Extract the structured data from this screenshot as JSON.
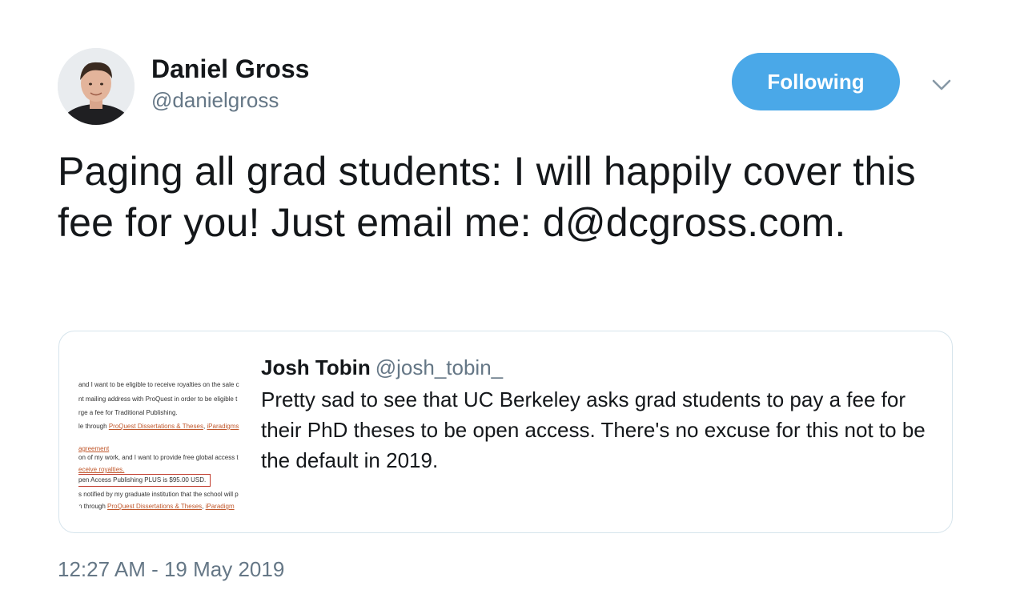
{
  "author": {
    "name": "Daniel Gross",
    "handle": "@danielgross"
  },
  "follow_button": {
    "label": "Following",
    "color": "#4aa8e8"
  },
  "menu_icon": "chevron-down-icon",
  "tweet": {
    "text": "Paging all grad students: I will happily cover this fee for you! Just email me: d@dcgross.com.",
    "timestamp": "12:27 AM - 19 May 2019"
  },
  "quoted_tweet": {
    "name": "Josh Tobin",
    "handle": "@josh_tobin_",
    "text": "Pretty sad to see that UC Berkeley asks grad students to pay a fee for their PhD theses to be open access. There's no excuse for this not to be the default in 2019.",
    "thumbnail_lines": [
      "and I want to be eligible to receive royalties on the sale c",
      "nt mailing address with ProQuest in order to be eligible t",
      "rge a fee for Traditional Publishing.",
      "le through ",
      "agreement",
      "on of my work, and I want to provide free global access t",
      "eceive royalties.",
      "pen Access Publishing PLUS is $95.00 USD.",
      "s notified by my graduate institution that the school will p",
      "n through "
    ],
    "thumbnail_links": [
      "ProQuest Dissertations & Theses",
      "iParadigms",
      "ProQuest Dissertations & Theses",
      "iParadigm"
    ]
  }
}
